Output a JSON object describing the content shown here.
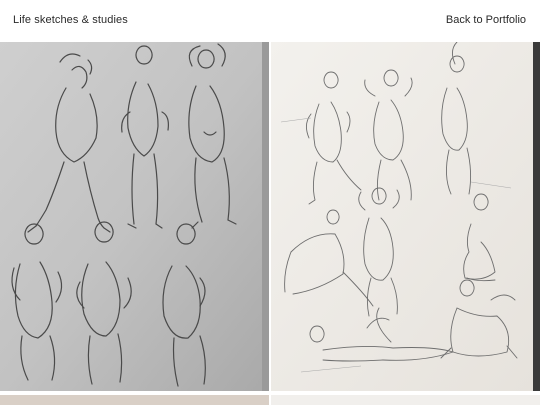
{
  "header": {
    "site_title": "Life sketches & studies",
    "back_label": "Back to Portfolio"
  },
  "gallery": {
    "images": [
      {
        "name": "sketch-sheet-grey",
        "tone": "#bdbdbd"
      },
      {
        "name": "sketch-sheet-cream",
        "tone": "#eeebe6"
      }
    ]
  }
}
